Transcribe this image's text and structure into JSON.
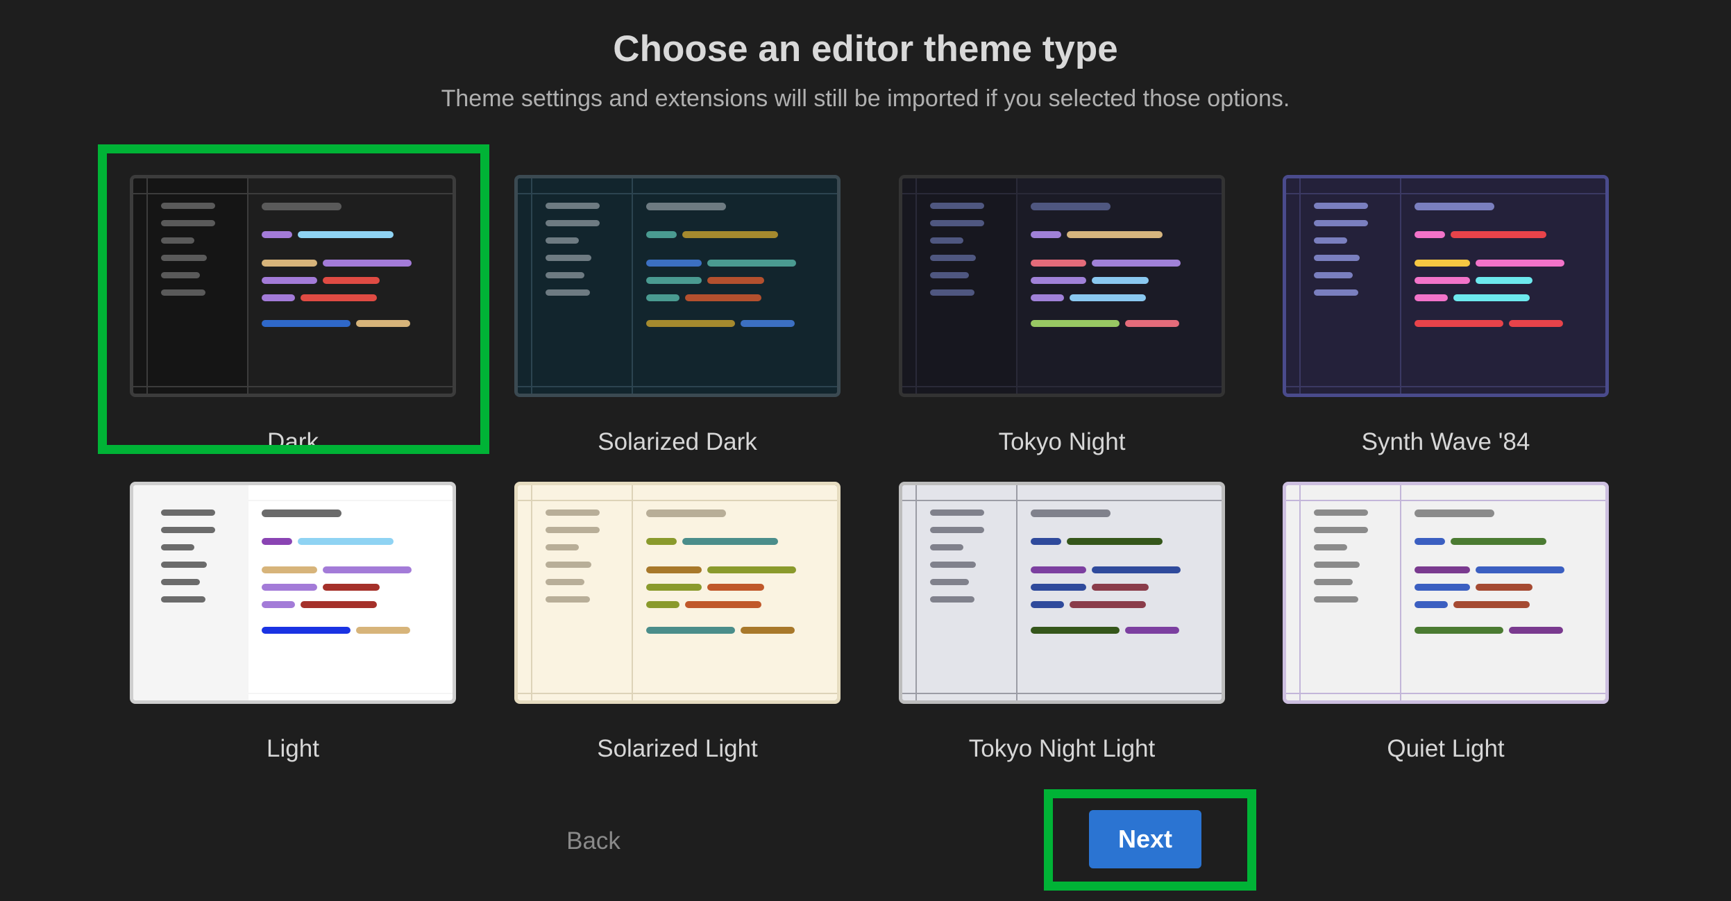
{
  "header": {
    "title": "Choose an editor theme type",
    "subtitle": "Theme settings and extensions will still be imported if you selected those options."
  },
  "themes": [
    {
      "label": "Dark",
      "selected": true,
      "colors": {
        "sidebar_bg": "#151515",
        "editor_bg": "#1e1e1e",
        "border": "#3c3c3c",
        "sidebar_line": "#3c3c3c",
        "tab_bg": "#1e1e1e",
        "tab_line": "#3c3c3c",
        "sidebar_items": "#5a5a5a",
        "code": [
          [
            "#a37bd8",
            "#8fd3f3"
          ],
          [
            "#d7b47a",
            "#a37bd8"
          ],
          [
            "#a37bd8",
            "#e04b43"
          ],
          [
            "#a37bd8",
            "#e04b43"
          ],
          [
            "#2f68c9",
            "#d7b47a"
          ]
        ]
      }
    },
    {
      "label": "Solarized Dark",
      "selected": false,
      "colors": {
        "sidebar_bg": "#12252d",
        "editor_bg": "#12252d",
        "border": "#3b4a52",
        "sidebar_line": "#2c4450",
        "tab_bg": "#12252d",
        "tab_line": "#2c4450",
        "sidebar_items": "#6e7b82",
        "code": [
          [
            "#4a9b91",
            "#a58a2e"
          ],
          [
            "#3c70c2",
            "#4a9b91"
          ],
          [
            "#4a9b91",
            "#b3502e"
          ],
          [
            "#4a9b91",
            "#b3502e"
          ],
          [
            "#a58a2e",
            "#3c70c2"
          ]
        ]
      }
    },
    {
      "label": "Tokyo Night",
      "selected": false,
      "colors": {
        "sidebar_bg": "#17171f",
        "editor_bg": "#1b1b26",
        "border": "#333333",
        "sidebar_line": "#2a2a38",
        "tab_bg": "#1b1b26",
        "tab_line": "#2a2a38",
        "sidebar_items": "#4f5780",
        "code": [
          [
            "#a081d8",
            "#d6b57e"
          ],
          [
            "#e46b7a",
            "#a081d8"
          ],
          [
            "#a081d8",
            "#8ac8f0"
          ],
          [
            "#a081d8",
            "#8ac8f0"
          ],
          [
            "#98c863",
            "#e46b7a"
          ]
        ]
      }
    },
    {
      "label": "Synth Wave '84",
      "selected": false,
      "colors": {
        "sidebar_bg": "#24213a",
        "editor_bg": "#24213a",
        "border": "#4a4b8c",
        "sidebar_line": "#3b3963",
        "tab_bg": "#24213a",
        "tab_line": "#3b3963",
        "sidebar_items": "#7a7fbf",
        "code": [
          [
            "#f273c9",
            "#e8434a"
          ],
          [
            "#f6c742",
            "#f273c9"
          ],
          [
            "#f273c9",
            "#6de9ee"
          ],
          [
            "#f273c9",
            "#6de9ee"
          ],
          [
            "#e8434a",
            "#e8434a"
          ]
        ]
      }
    },
    {
      "label": "Light",
      "selected": false,
      "colors": {
        "sidebar_bg": "#f5f5f5",
        "editor_bg": "#ffffff",
        "border": "#cfcfcf",
        "sidebar_line": "#f5f5f5",
        "tab_bg": "#ffffff",
        "tab_line": "#f5f5f5",
        "sidebar_items": "#6b6b6b",
        "code": [
          [
            "#8a44b3",
            "#8fd3f3"
          ],
          [
            "#d7b47a",
            "#a37bd8"
          ],
          [
            "#a37bd8",
            "#a5312a"
          ],
          [
            "#a37bd8",
            "#a5312a"
          ],
          [
            "#1a33e3",
            "#d7b47a"
          ]
        ]
      }
    },
    {
      "label": "Solarized Light",
      "selected": false,
      "colors": {
        "sidebar_bg": "#faf3e1",
        "editor_bg": "#faf3e1",
        "border": "#e6dcc0",
        "sidebar_line": "#ddd3b8",
        "tab_bg": "#faf3e1",
        "tab_line": "#ddd3b8",
        "sidebar_items": "#b8ae98",
        "code": [
          [
            "#8a9a2c",
            "#4a8d8a"
          ],
          [
            "#a8782a",
            "#8a9a2c"
          ],
          [
            "#8a9a2c",
            "#c0582a"
          ],
          [
            "#8a9a2c",
            "#c0582a"
          ],
          [
            "#4a8d8a",
            "#a8782a"
          ]
        ]
      }
    },
    {
      "label": "Tokyo Night Light",
      "selected": false,
      "colors": {
        "sidebar_bg": "#e3e4ea",
        "editor_bg": "#e3e4ea",
        "border": "#bdbdbd",
        "sidebar_line": "#9b9ca5",
        "tab_bg": "#e3e4ea",
        "tab_line": "#9b9ca5",
        "sidebar_items": "#80818c",
        "code": [
          [
            "#2f4a9c",
            "#35561b"
          ],
          [
            "#7c3fa0",
            "#2f4a9c"
          ],
          [
            "#2f4a9c",
            "#8a3c4a"
          ],
          [
            "#2f4a9c",
            "#8a3c4a"
          ],
          [
            "#35561b",
            "#7c3fa0"
          ]
        ]
      }
    },
    {
      "label": "Quiet Light",
      "selected": false,
      "colors": {
        "sidebar_bg": "#f1f1f1",
        "editor_bg": "#f1f1f1",
        "border": "#cdbfe0",
        "sidebar_line": "#c3b6d9",
        "tab_bg": "#f1f1f1",
        "tab_line": "#c3b6d9",
        "sidebar_items": "#8b8b8b",
        "code": [
          [
            "#3b5fc1",
            "#4b7b32"
          ],
          [
            "#7a3a8f",
            "#3b5fc1"
          ],
          [
            "#3b5fc1",
            "#a54a32"
          ],
          [
            "#3b5fc1",
            "#a54a32"
          ],
          [
            "#4b7b32",
            "#7a3a8f"
          ]
        ]
      }
    }
  ],
  "footer": {
    "back_label": "Back",
    "next_label": "Next"
  },
  "accent": {
    "highlight": "#00b336",
    "primary_button": "#2b74d2"
  }
}
